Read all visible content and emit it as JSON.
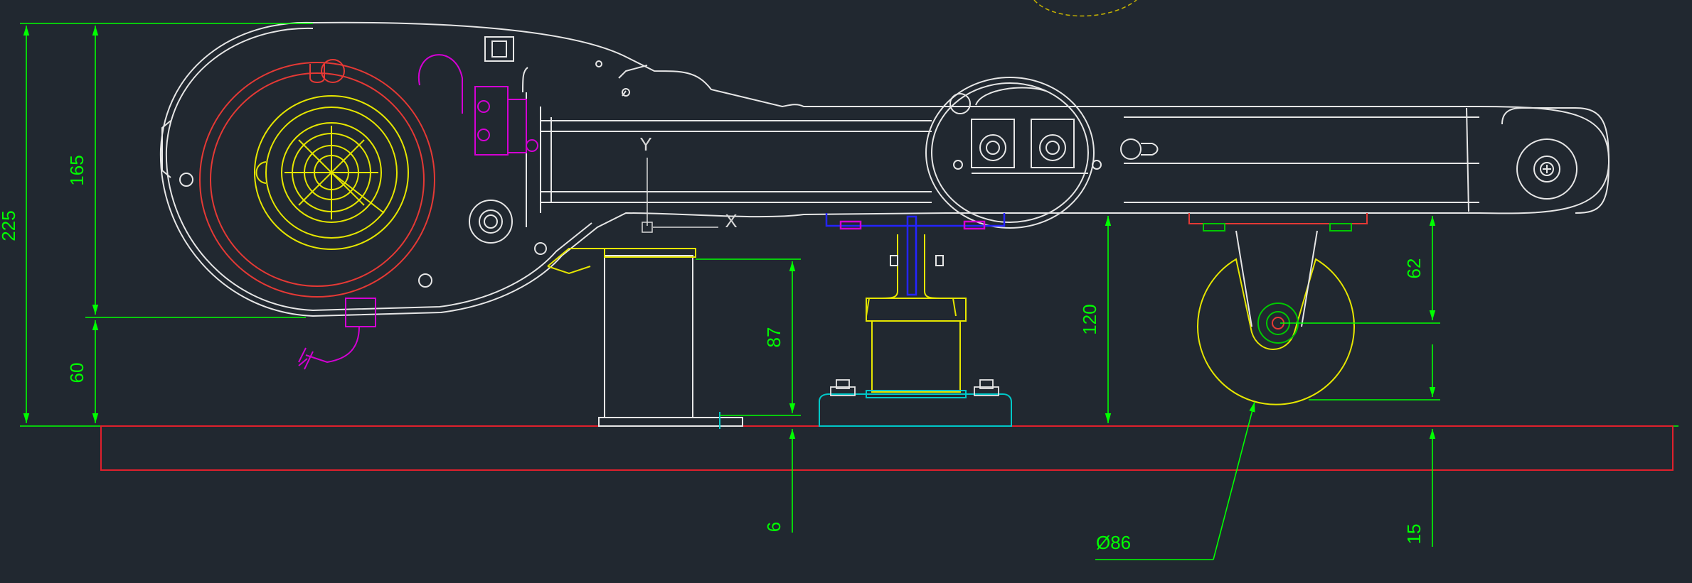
{
  "drawing": {
    "background": "#212830",
    "colors": {
      "outline": "#e6e6e6",
      "dimension": "#00ff00",
      "motor": "#e53935",
      "gear": "#e6e600",
      "cable": "#d400d4",
      "bracket": "#2424ff",
      "foot": "#00c8c8",
      "floor": "#e0202c"
    },
    "dimensions": {
      "overall_height": "225",
      "body_height": "165",
      "base_clearance": "60",
      "post_height": "87",
      "floor_offset": "6",
      "foot_height": "120",
      "caster_height": "62",
      "caster_clearance": "15",
      "wheel_diameter": "Ø86"
    },
    "axes": {
      "y": "Y",
      "x": "X"
    }
  }
}
